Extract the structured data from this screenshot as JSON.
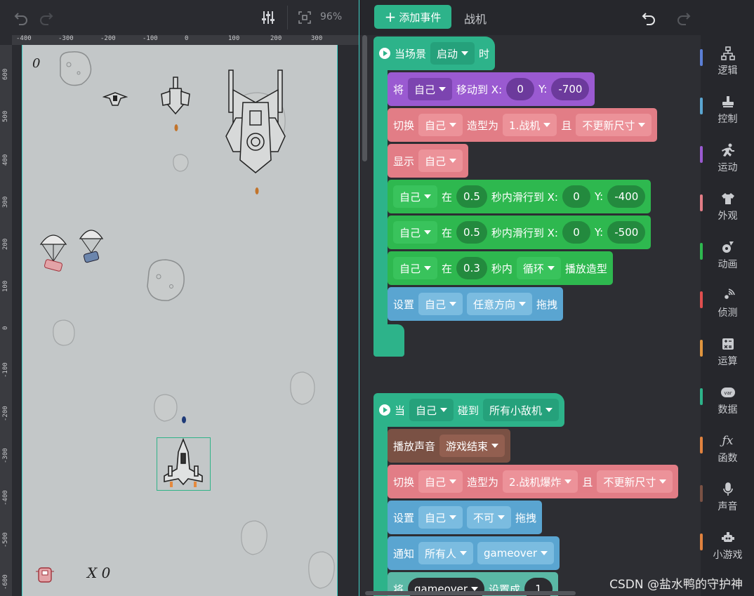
{
  "stage_toolbar": {
    "zoom": "96%"
  },
  "ruler": {
    "top": [
      "-400",
      "-300",
      "-200",
      "-100",
      "0",
      "100",
      "200",
      "300"
    ],
    "left": [
      "600",
      "500",
      "400",
      "300",
      "200",
      "100",
      "0",
      "-100",
      "-200",
      "-300",
      "-400",
      "-500",
      "-600"
    ]
  },
  "stage": {
    "score": "0",
    "lives": "X 0"
  },
  "header": {
    "add_event": "添加事件",
    "sprite_name": "战机"
  },
  "script1": {
    "hat": {
      "prefix": "当场景",
      "scene": "启动",
      "suffix": "时"
    },
    "move": {
      "label": "将",
      "target": "自己",
      "mid": "移动到 X:",
      "x": "0",
      "ylab": "Y:",
      "y": "-700"
    },
    "costume": {
      "label": "切换",
      "target": "自己",
      "mid": "造型为",
      "costume": "1.战机",
      "and": "且",
      "resize": "不更新尺寸"
    },
    "show": {
      "label": "显示",
      "target": "自己"
    },
    "glide1": {
      "target": "自己",
      "in": "在",
      "secs": "0.5",
      "mid": "秒内滑行到 X:",
      "x": "0",
      "ylab": "Y:",
      "y": "-400"
    },
    "glide2": {
      "target": "自己",
      "in": "在",
      "secs": "0.5",
      "mid": "秒内滑行到 X:",
      "x": "0",
      "ylab": "Y:",
      "y": "-500"
    },
    "anim": {
      "target": "自己",
      "in": "在",
      "secs": "0.3",
      "mid": "秒内",
      "mode": "循环",
      "tail": "播放造型"
    },
    "drag": {
      "label": "设置",
      "target": "自己",
      "mode": "任意方向",
      "tail": "拖拽"
    }
  },
  "script2": {
    "hat": {
      "prefix": "当",
      "target": "自己",
      "mid": "碰到",
      "other": "所有小敌机"
    },
    "sound": {
      "label": "播放声音",
      "sound": "游戏结束"
    },
    "costume": {
      "label": "切换",
      "target": "自己",
      "mid": "造型为",
      "costume": "2.战机爆炸",
      "and": "且",
      "resize": "不更新尺寸"
    },
    "drag": {
      "label": "设置",
      "target": "自己",
      "mode": "不可",
      "tail": "拖拽"
    },
    "notify": {
      "label": "通知",
      "target": "所有人",
      "msg": "gameover"
    },
    "setvar": {
      "label": "将",
      "var": "gameover",
      "mid": "设置成",
      "value": "1"
    }
  },
  "categories": [
    {
      "label": "逻辑",
      "icon": "logic-icon",
      "color": "#5b7fd6"
    },
    {
      "label": "控制",
      "icon": "control-icon",
      "color": "#5aa5d1"
    },
    {
      "label": "运动",
      "icon": "motion-icon",
      "color": "#9a5ad1"
    },
    {
      "label": "外观",
      "icon": "looks-icon",
      "color": "#e27d86"
    },
    {
      "label": "动画",
      "icon": "animation-icon",
      "color": "#2eb84f"
    },
    {
      "label": "侦测",
      "icon": "sensing-icon",
      "color": "#e04f4f"
    },
    {
      "label": "运算",
      "icon": "operator-icon",
      "color": "#e0953e"
    },
    {
      "label": "数据",
      "icon": "data-icon",
      "color": "#2db38a"
    },
    {
      "label": "函数",
      "icon": "function-icon",
      "color": "#e0823e"
    },
    {
      "label": "声音",
      "icon": "sound-icon",
      "color": "#7a5144"
    },
    {
      "label": "小游戏",
      "icon": "minigame-icon",
      "color": "#e0823e"
    }
  ],
  "watermark": "CSDN @盐水鸭的守护神"
}
